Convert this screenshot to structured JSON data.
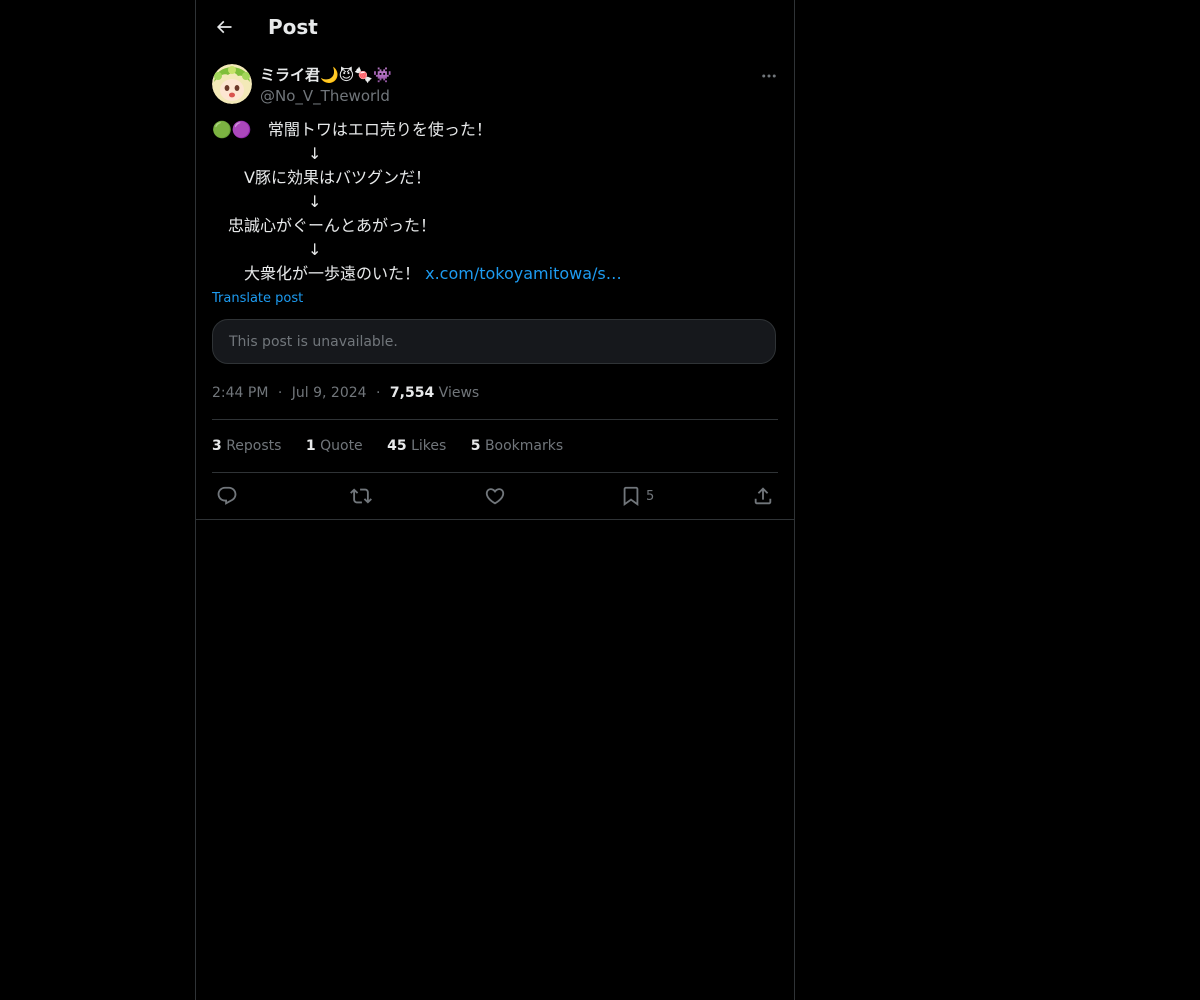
{
  "header": {
    "title": "Post",
    "back_icon": "arrow-left-icon"
  },
  "author": {
    "display_name": "ミライ君🌙😈🍬👾",
    "handle": "@No_V_Theworld",
    "avatar_icon": "avatar-image"
  },
  "post": {
    "lines": [
      "🟢🟣　常闇トワはエロ売りを使った！",
      "　　　　　　↓",
      "　　V豚に効果はバツグンだ！",
      "　　　　　　↓",
      "　忠誠心がぐーんとあがった！",
      "　　　　　　↓",
      "　　大衆化が一歩遠のいた！ "
    ],
    "link_text": "x.com/tokoyamitowa/s…",
    "translate_label": "Translate post",
    "quoted_unavailable": "This post is unavailable."
  },
  "meta": {
    "time": "2:44 PM",
    "date": "Jul 9, 2024",
    "views_count": "7,554",
    "views_label": "Views",
    "separator": "·"
  },
  "stats": {
    "reposts_count": "3",
    "reposts_label": "Reposts",
    "quotes_count": "1",
    "quotes_label": "Quote",
    "likes_count": "45",
    "likes_label": "Likes",
    "bookmarks_count": "5",
    "bookmarks_label": "Bookmarks"
  },
  "actions": {
    "bookmark_count": "5",
    "icons": [
      "reply-icon",
      "repost-icon",
      "like-icon",
      "bookmark-icon",
      "share-icon"
    ]
  },
  "colors": {
    "background": "#000000",
    "text": "#e7e9ea",
    "muted": "#71767b",
    "accent": "#1d9bf0",
    "border": "#2f3336"
  }
}
